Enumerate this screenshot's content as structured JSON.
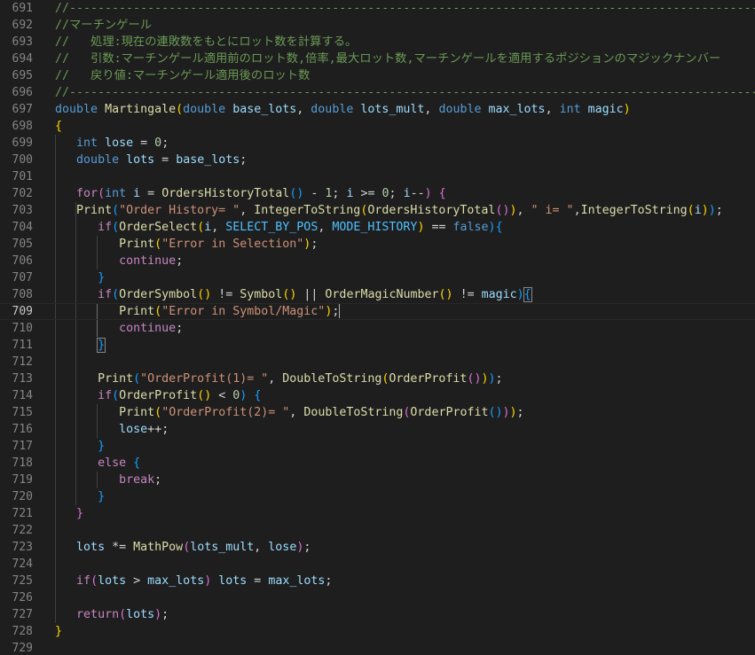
{
  "editor": {
    "current_line": "709",
    "lines": [
      {
        "num": "691",
        "text": "//------------------------------------------------------------------------------------------------------------"
      },
      {
        "num": "692",
        "text": "//マーチンゲール"
      },
      {
        "num": "693",
        "text": "//   処理:現在の連敗数をもとにロット数を計算する。"
      },
      {
        "num": "694",
        "text": "//   引数:マーチンゲール適用前のロット数,倍率,最大ロット数,マーチンゲールを適用するポジションのマジックナンバー"
      },
      {
        "num": "695",
        "text": "//   戻り値:マーチンゲール適用後のロット数"
      },
      {
        "num": "696",
        "text": "//------------------------------------------------------------------------------------------------------------"
      },
      {
        "num": "697",
        "text": "double Martingale(double base_lots, double lots_mult, double max_lots, int magic)"
      },
      {
        "num": "698",
        "text": "{"
      },
      {
        "num": "699",
        "text": "   int lose = 0;"
      },
      {
        "num": "700",
        "text": "   double lots = base_lots;"
      },
      {
        "num": "701",
        "text": ""
      },
      {
        "num": "702",
        "text": "   for(int i = OrdersHistoryTotal() - 1; i >= 0; i--) {"
      },
      {
        "num": "703",
        "text": "   Print(\"Order History= \", IntegerToString(OrdersHistoryTotal()), \" i= \",IntegerToString(i));"
      },
      {
        "num": "704",
        "text": "      if(OrderSelect(i, SELECT_BY_POS, MODE_HISTORY) == false){"
      },
      {
        "num": "705",
        "text": "         Print(\"Error in Selection\");"
      },
      {
        "num": "706",
        "text": "         continue;"
      },
      {
        "num": "707",
        "text": "      }"
      },
      {
        "num": "708",
        "text": "      if(OrderSymbol() != Symbol() || OrderMagicNumber() != magic){"
      },
      {
        "num": "709",
        "text": "         Print(\"Error in Symbol/Magic\");"
      },
      {
        "num": "710",
        "text": "         continue;"
      },
      {
        "num": "711",
        "text": "      }"
      },
      {
        "num": "712",
        "text": ""
      },
      {
        "num": "713",
        "text": "      Print(\"OrderProfit(1)= \", DoubleToString(OrderProfit()));"
      },
      {
        "num": "714",
        "text": "      if(OrderProfit() < 0) {"
      },
      {
        "num": "715",
        "text": "         Print(\"OrderProfit(2)= \", DoubleToString(OrderProfit()));"
      },
      {
        "num": "716",
        "text": "         lose++;"
      },
      {
        "num": "717",
        "text": "      }"
      },
      {
        "num": "718",
        "text": "      else {"
      },
      {
        "num": "719",
        "text": "         break;"
      },
      {
        "num": "720",
        "text": "      }"
      },
      {
        "num": "721",
        "text": "   }"
      },
      {
        "num": "722",
        "text": ""
      },
      {
        "num": "723",
        "text": "   lots *= MathPow(lots_mult, lose);"
      },
      {
        "num": "724",
        "text": ""
      },
      {
        "num": "725",
        "text": "   if(lots > max_lots) lots = max_lots;"
      },
      {
        "num": "726",
        "text": ""
      },
      {
        "num": "727",
        "text": "   return(lots);"
      },
      {
        "num": "728",
        "text": "}"
      },
      {
        "num": "729",
        "text": ""
      }
    ]
  },
  "colors": {
    "background": "#1e1e1e",
    "comment": "#6a9955",
    "keyword": "#569cd6",
    "control": "#c586c0",
    "function": "#dcdcaa",
    "variable": "#9cdcfe",
    "string": "#ce9178",
    "number": "#b5cea8",
    "constant": "#4fc1ff",
    "bracket_level_1": "#ffd700",
    "bracket_level_2": "#da70d6",
    "bracket_level_3": "#179fff",
    "line_number": "#858585"
  }
}
